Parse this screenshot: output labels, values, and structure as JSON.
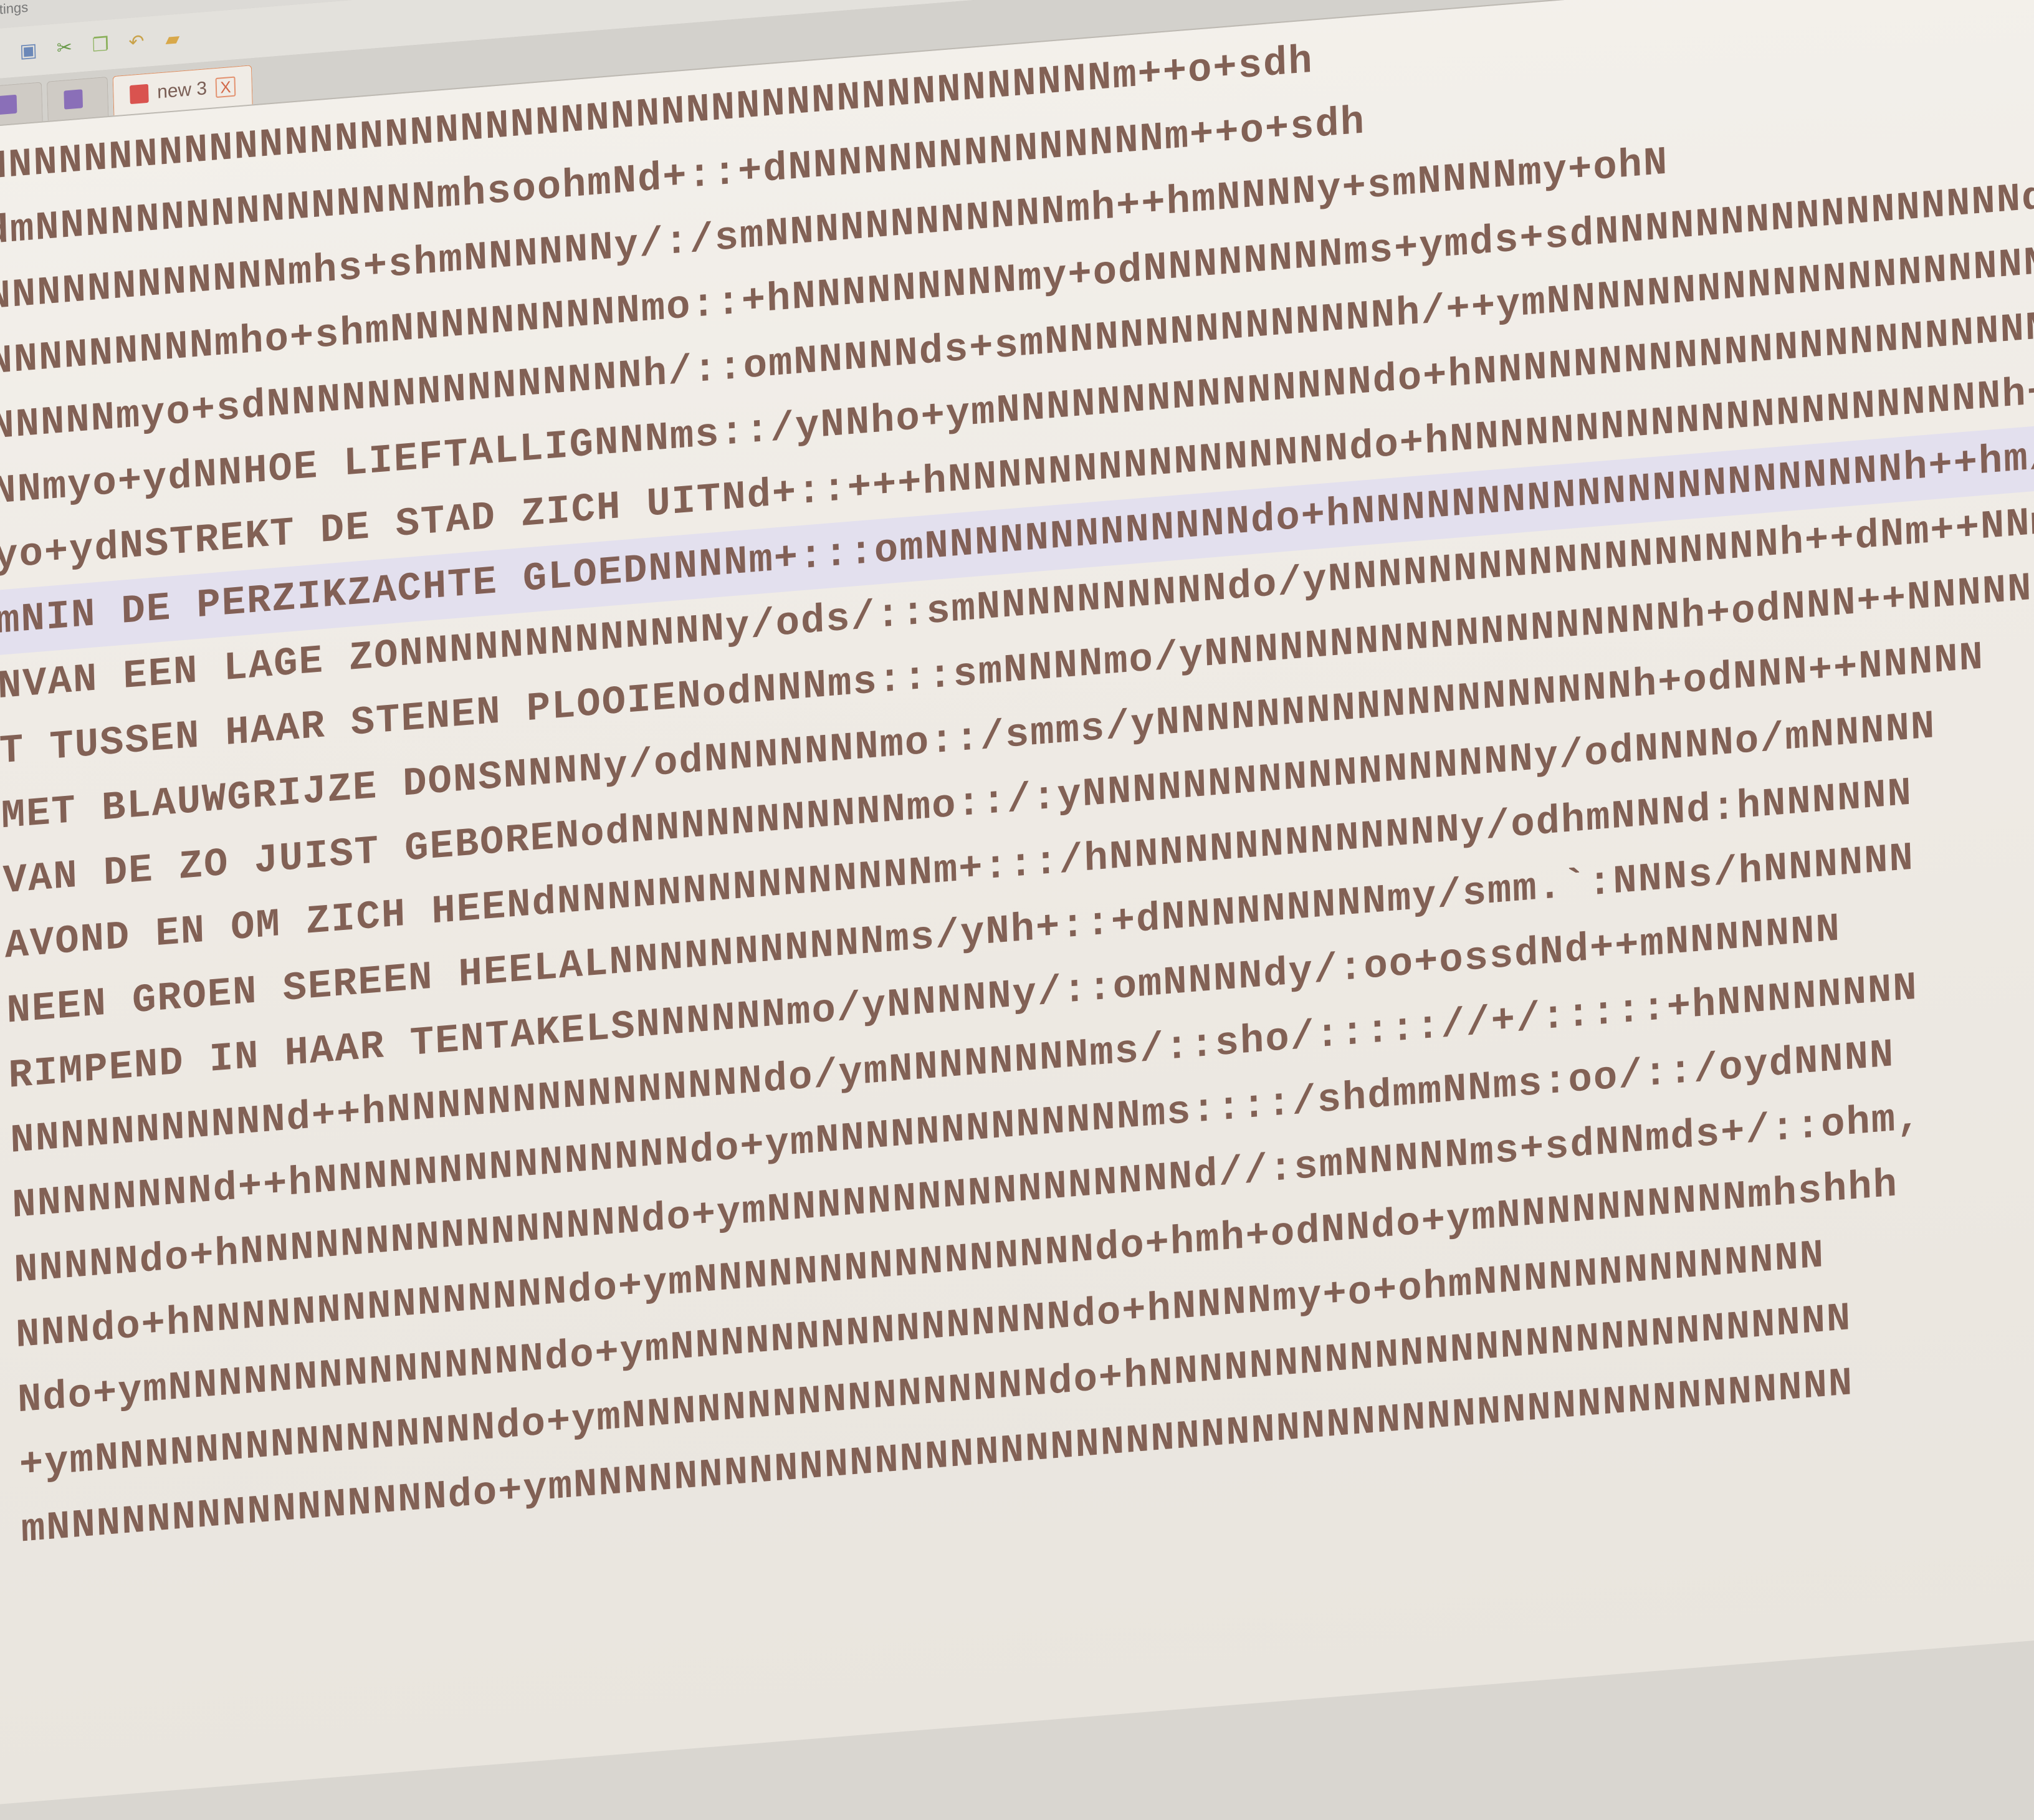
{
  "menubar": {
    "item_settings": "Settings"
  },
  "toolbar": {
    "icons": [
      "new-file-icon",
      "save-icon",
      "cut-icon",
      "copy-icon",
      "undo-icon",
      "folder-icon"
    ]
  },
  "tabs": [
    {
      "label": ""
    },
    {
      "label": ""
    },
    {
      "label": "new 3",
      "close": "X"
    }
  ],
  "editor": {
    "lines": [
      "NNNNNNNNNNNNNNNNNNNNNNNNNNNNNNNNNNNNNNNNNNNNNm++o+sdh",
      "dmNNNNNNNNNNNNNNNNmhsoohmNd+::+dNNNNNNNNNNNNNNNm++o+sdh",
      "NNNNNNNNNNNNmhs+shmNNNNNNy/:/smNNNNNNNNNNNNmh++hmNNNNy+smNNNNmy+ohN",
      "NNNNNNNNNmho+shmNNNNNNNNNNmo::+hNNNNNNNNNmy+odNNNNNNNNms+ymds+sdNNNNNNNNNNNNNNNNNd++",
      "NNNNNmyo+sdNNNNNNNNNNNNNNNh/::omNNNNNds+smNNNNNNNNNNNNNNh/++ymNNNNNNNNNNNNNNNNNNNNNNNNdo:sh",
      "NNmyo+ydNNHOE LIEFTALLIGNNNms::/yNNho+ymNNNNNNNNNNNNNNNdo+hNNNNNNNNNNNNNNNNNNNNNNNdo/:sNN",
      "yo+ydNSTREKT DE STAD ZICH UITNd+::+++hNNNNNNNNNNNNNNNNdo+hNNNNNNNNNNNNNNNNNNNNNNh++y/oNN",
      "mNIN DE PERZIKZACHTE GLOEDNNNNm+:::omNNNNNNNNNNNNNdo+hNNNNNNNNNNNNNNNNNNNNNNh++hm/oNNm",
      "NVAN EEN LAGE ZONNNNNNNNNNNNNy/ods/::smNNNNNNNNNNdo/yNNNNNNNNNNNNNNNNNNh++dNm++NNmm",
      "T TUSSEN HAAR STENEN PLOOIENodNNNms:::smNNNNmo/yNNNNNNNNNNNNNNNNNNNh+odNNN++NNNNN",
      "MET BLAUWGRIJZE DONSNNNNy/odNNNNNNNmo::/smms/yNNNNNNNNNNNNNNNNNNNh+odNNN++NNNNN",
      "VAN DE ZO JUIST GEBORENodNNNNNNNNNNNmo::/:yNNNNNNNNNNNNNNNNNNy/odNNNNo/mNNNNN",
      "AVOND EN OM ZICH HEENdNNNNNNNNNNNNNNNm+:::/hNNNNNNNNNNNNNNy/odhmNNNd:hNNNNNN",
      "NEEN GROEN SEREEN HEELALNNNNNNNNNNNms/yNh+::+dNNNNNNNNNmy/smm.`:NNNs/hNNNNNN",
      "RIMPEND IN HAAR TENTAKELSNNNNNNmo/yNNNNNy/::omNNNNdy/:oo+ossdNd++mNNNNNNN",
      "NNNNNNNNNNNd++hNNNNNNNNNNNNNNNdo/ymNNNNNNNNms/::sho/::::://+/:::::+hNNNNNNNN",
      "NNNNNNNNd++hNNNNNNNNNNNNNNNdo+ymNNNNNNNNNNNNNms::::/shdmmNNms:oo/::/oydNNNN",
      "NNNNNdo+hNNNNNNNNNNNNNNNNdo+ymNNNNNNNNNNNNNNNNNd//:smNNNNNms+sdNNmds+/::ohm,",
      "NNNdo+hNNNNNNNNNNNNNNNdo+ymNNNNNNNNNNNNNNNNdo+hmh+odNNdo+ymNNNNNNNNNNmhshhh",
      "Ndo+ymNNNNNNNNNNNNNNNdo+ymNNNNNNNNNNNNNNNNdo+hNNNNmy+o+ohmNNNNNNNNNNNNNN",
      "+ymNNNNNNNNNNNNNNNNdo+ymNNNNNNNNNNNNNNNNNdo+hNNNNNNNNNNNNNNNNNNNNNNNNNNNN",
      "mNNNNNNNNNNNNNNNNdo+ymNNNNNNNNNNNNNNNNNNNNNNNNNNNNNNNNNNNNNNNNNNNNNNNNNNN"
    ]
  },
  "colors": {
    "text": "#7d5a4e",
    "background": "#f0ece6",
    "current_line": "#e3e0ee",
    "tab_accent": "#e08a5a"
  }
}
